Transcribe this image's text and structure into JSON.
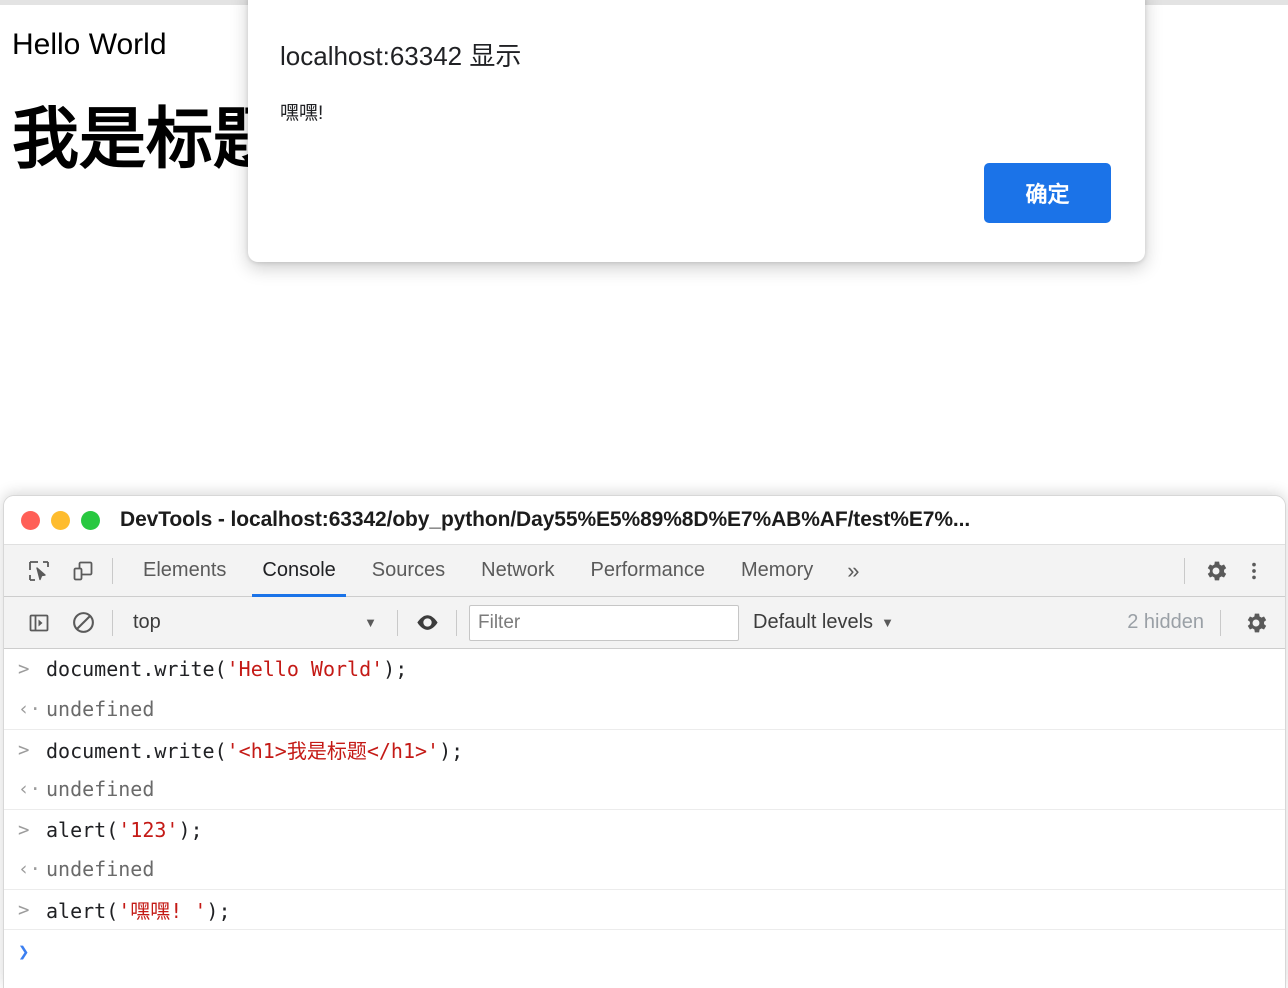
{
  "page": {
    "body_text": "Hello World",
    "heading": "我是标题"
  },
  "dialog": {
    "title": "localhost:63342 显示",
    "message": "嘿嘿!",
    "ok_label": "确定",
    "accent_color": "#1b73e8"
  },
  "devtools": {
    "window_title": "DevTools - localhost:63342/oby_python/Day55%E5%89%8D%E7%AB%AF/test%E7%...",
    "traffic_lights": {
      "close_color": "#ff5f57",
      "minimize_color": "#febc2e",
      "zoom_color": "#28c840"
    },
    "tabs": [
      {
        "label": "Elements",
        "active": false
      },
      {
        "label": "Console",
        "active": true
      },
      {
        "label": "Sources",
        "active": false
      },
      {
        "label": "Network",
        "active": false
      },
      {
        "label": "Performance",
        "active": false
      },
      {
        "label": "Memory",
        "active": false
      }
    ],
    "more_tabs_glyph": "»",
    "active_tab_underline_color": "#1a73e8",
    "filterbar": {
      "context": "top",
      "context_caret": "▼",
      "filter_placeholder": "Filter",
      "filter_value": "",
      "levels_label": "Default levels",
      "levels_caret": "▼",
      "hidden_label": "2 hidden"
    },
    "console_rows": [
      {
        "arrow": ">",
        "kind": "input",
        "sep": false,
        "parts": [
          {
            "t": "document.write(",
            "c": "plain"
          },
          {
            "t": "'Hello World'",
            "c": "string"
          },
          {
            "t": ");",
            "c": "plain"
          }
        ]
      },
      {
        "arrow": "‹·",
        "kind": "output",
        "sep": false,
        "parts": [
          {
            "t": "undefined",
            "c": "result"
          }
        ]
      },
      {
        "arrow": ">",
        "kind": "input",
        "sep": true,
        "parts": [
          {
            "t": "document.write(",
            "c": "plain"
          },
          {
            "t": "'<h1>我是标题</h1>'",
            "c": "string"
          },
          {
            "t": ");",
            "c": "plain"
          }
        ]
      },
      {
        "arrow": "‹·",
        "kind": "output",
        "sep": false,
        "parts": [
          {
            "t": "undefined",
            "c": "result"
          }
        ]
      },
      {
        "arrow": ">",
        "kind": "input",
        "sep": true,
        "parts": [
          {
            "t": "alert(",
            "c": "plain"
          },
          {
            "t": "'123'",
            "c": "string"
          },
          {
            "t": ");",
            "c": "plain"
          }
        ]
      },
      {
        "arrow": "‹·",
        "kind": "output",
        "sep": false,
        "parts": [
          {
            "t": "undefined",
            "c": "result"
          }
        ]
      },
      {
        "arrow": ">",
        "kind": "input",
        "sep": true,
        "parts": [
          {
            "t": "alert(",
            "c": "plain"
          },
          {
            "t": "'嘿嘿! '",
            "c": "string"
          },
          {
            "t": ");",
            "c": "plain"
          }
        ]
      }
    ],
    "prompt_arrow": "❯"
  }
}
